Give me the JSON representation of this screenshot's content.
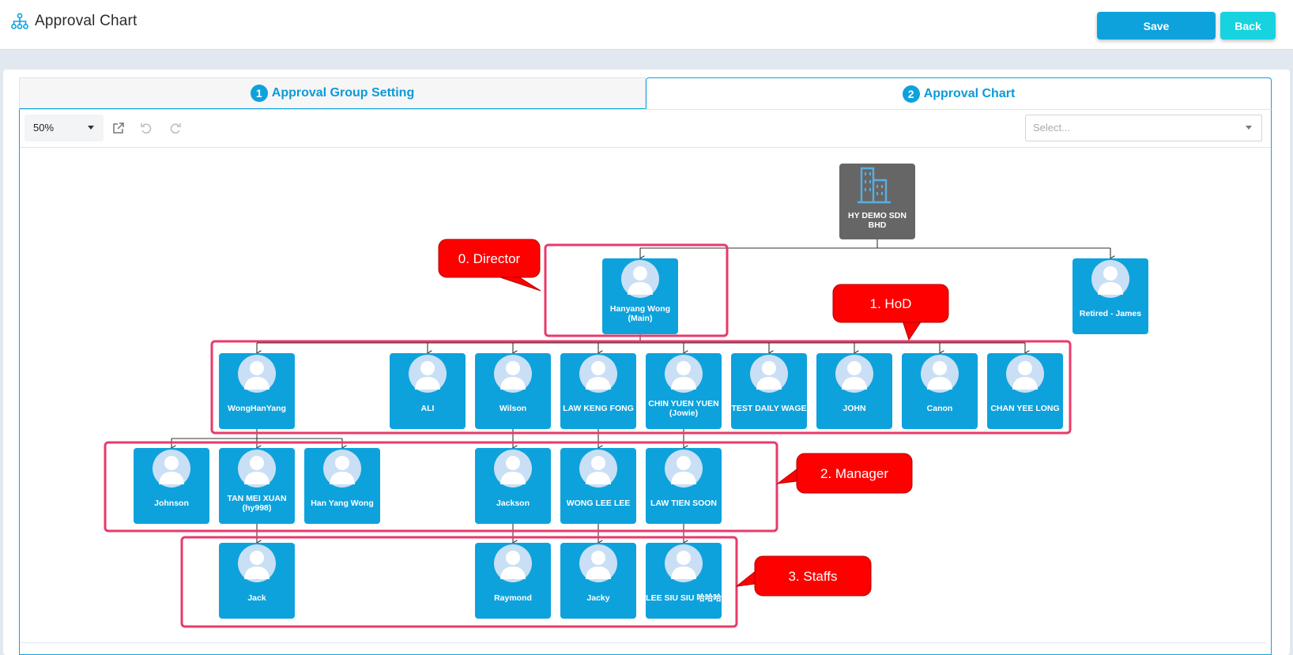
{
  "header": {
    "title": "Approval Chart",
    "save_label": "Save",
    "back_label": "Back",
    "app_icon": "org-chart-icon"
  },
  "tabs": [
    {
      "num": "1",
      "label": "Approval Group Setting",
      "active": false
    },
    {
      "num": "2",
      "label": "Approval Chart",
      "active": true
    }
  ],
  "toolbar": {
    "zoom": "50%",
    "select_placeholder": "Select...",
    "icons": [
      "export-icon",
      "undo-icon",
      "redo-icon"
    ]
  },
  "colors": {
    "accent": "#0ea2dc",
    "node": "#0ea2dc",
    "company_node": "#666666",
    "callout": "#ff0000",
    "highlight": "#e83a6a"
  },
  "org": {
    "company": "HY DEMO SDN BHD",
    "nodes": {
      "director": "Hanyang Wong (Main)",
      "retired": "Retired - James",
      "h1": "WongHanYang",
      "h2": "ALI",
      "h3": "Wilson",
      "h4": "LAW KENG FONG",
      "h5": "CHIN YUEN YUEN (Jowie)",
      "h6": "TEST DAILY WAGE",
      "h7": "JOHN",
      "h8": "Canon",
      "h9": "CHAN YEE LONG",
      "m1": "Johnson",
      "m2": "TAN MEI XUAN (hy998)",
      "m3": "Han Yang Wong",
      "m4": "Jackson",
      "m5": "WONG LEE LEE",
      "m6": "LAW TIEN SOON",
      "s1": "Jack",
      "s2": "Raymond",
      "s3": "Jacky",
      "s4": "LEE SIU SIU 哈哈哈"
    }
  },
  "callouts": {
    "director": "0. Director",
    "hod": "1. HoD",
    "manager": "2. Manager",
    "staffs": "3. Staffs"
  }
}
